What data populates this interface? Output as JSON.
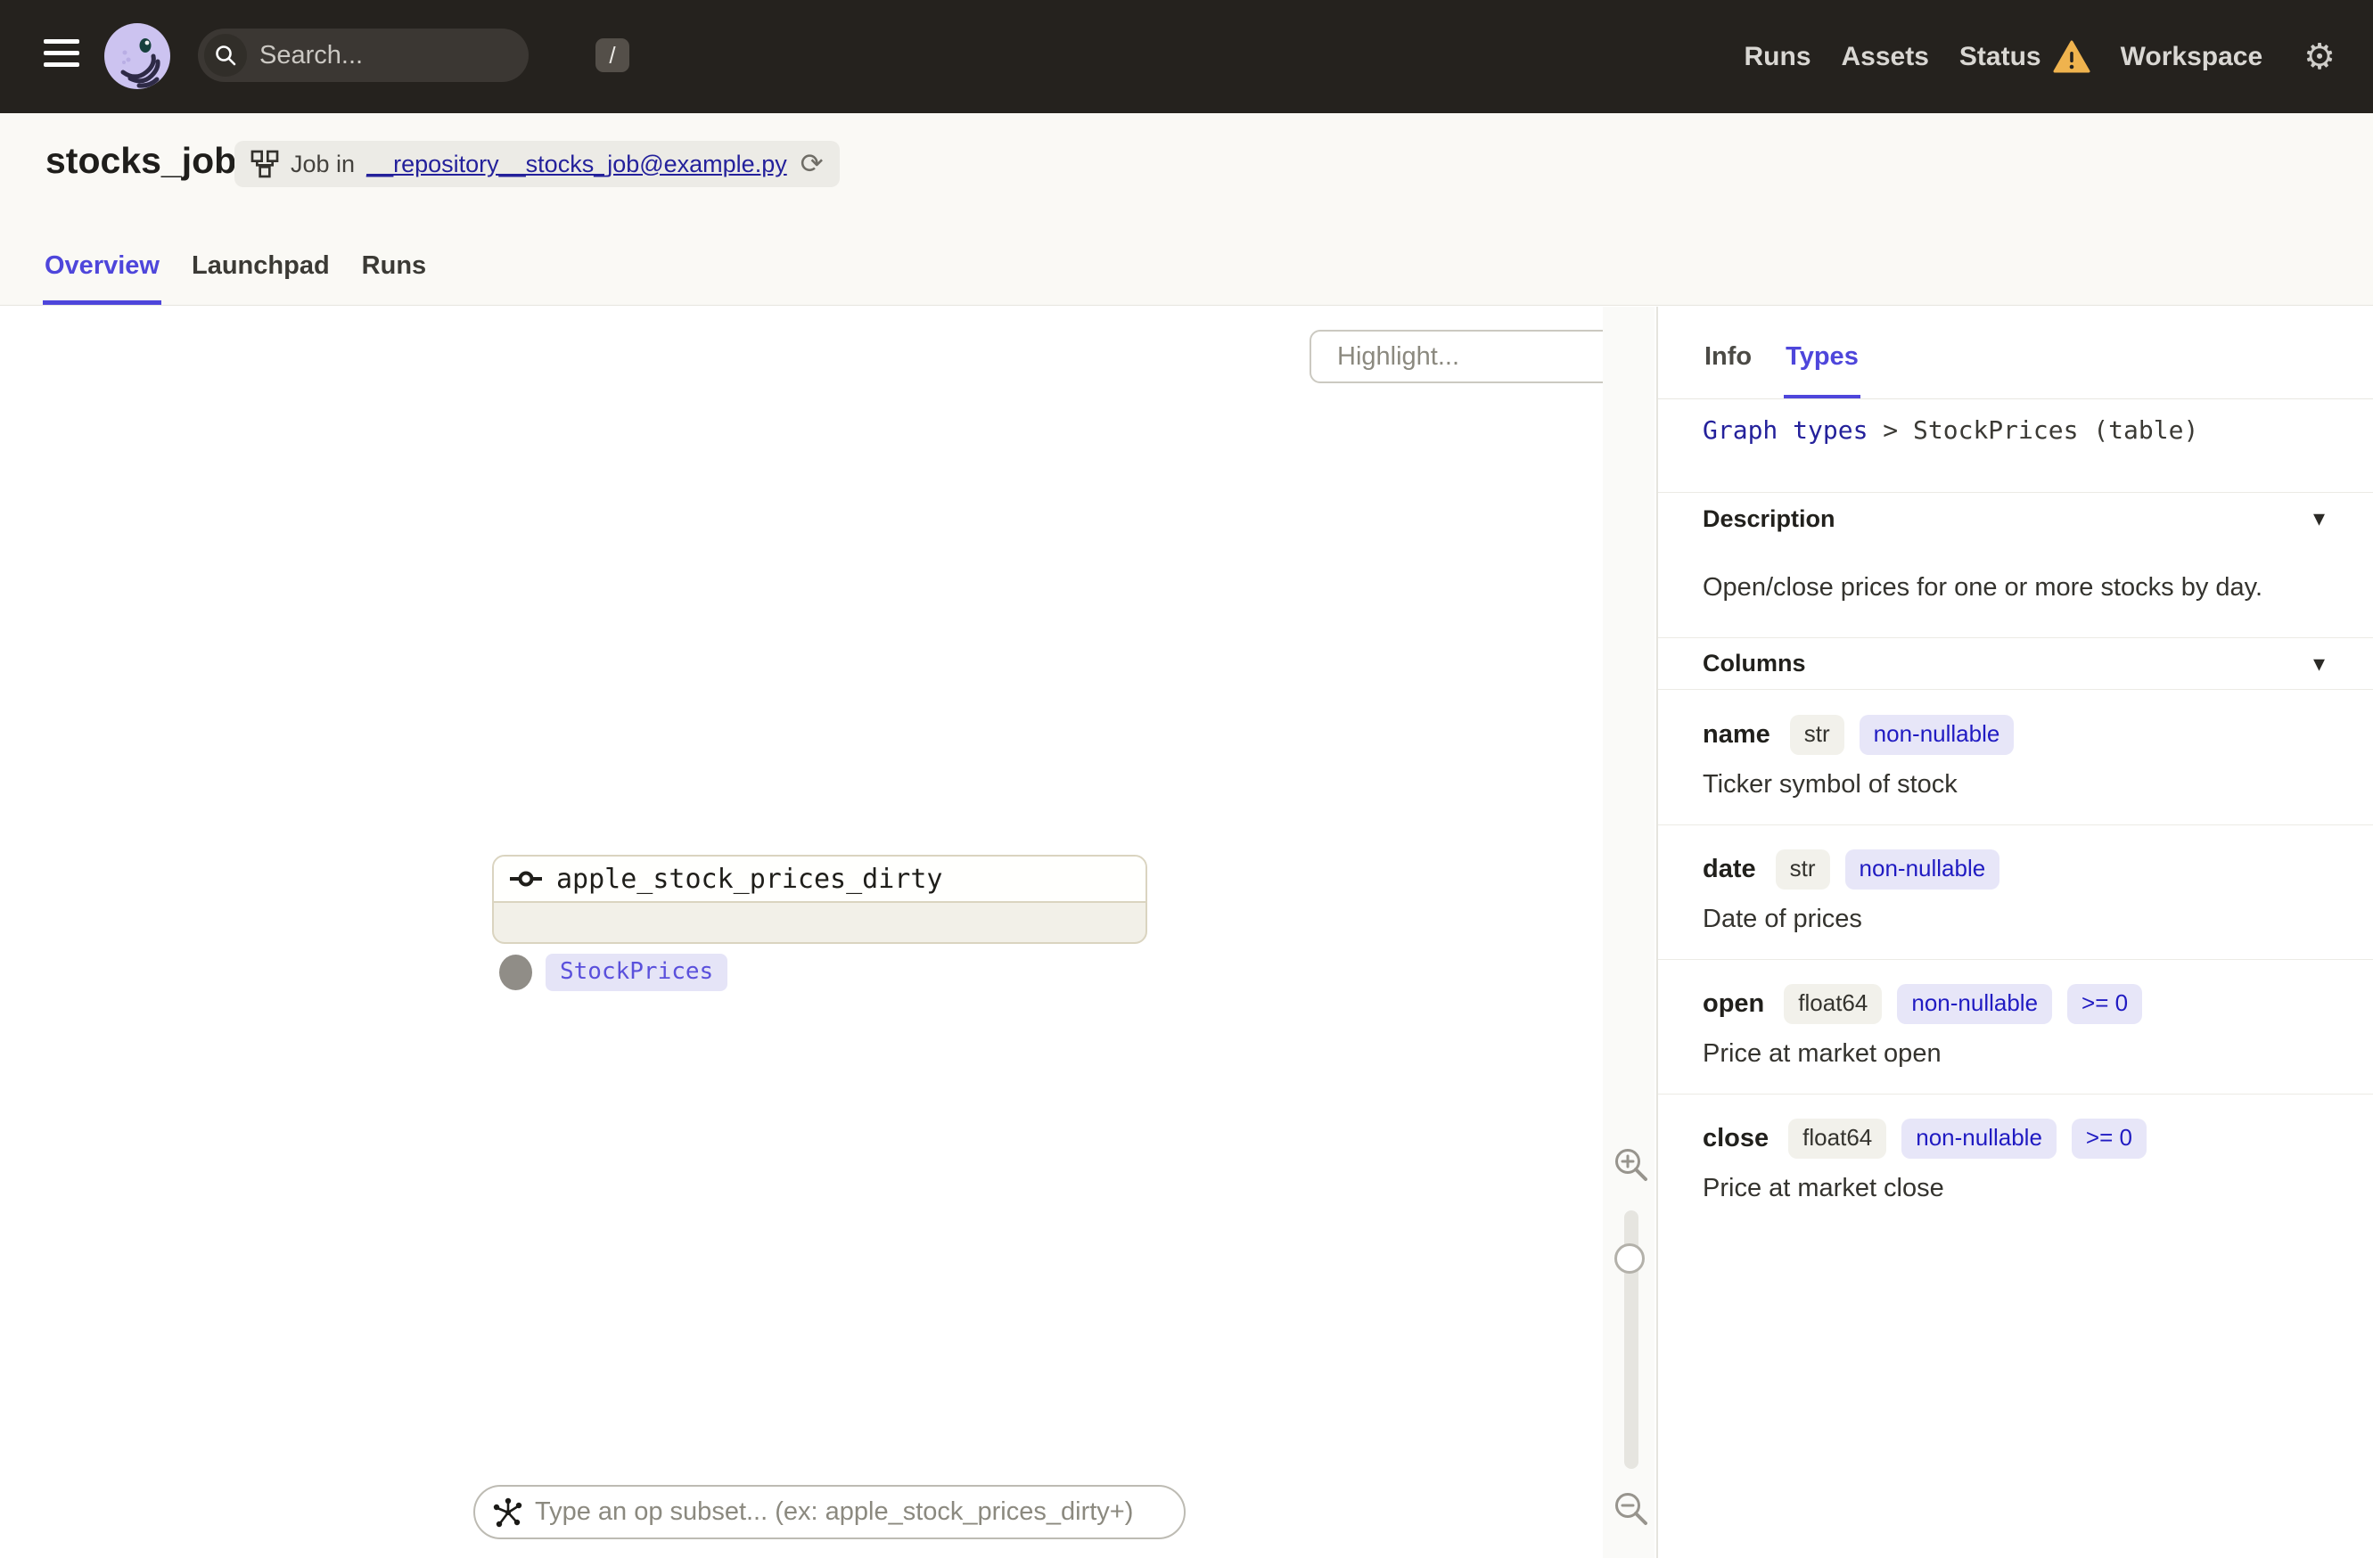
{
  "nav": {
    "search": {
      "placeholder": "Search...",
      "shortcut": "/"
    },
    "items": [
      {
        "label": "Runs"
      },
      {
        "label": "Assets"
      },
      {
        "label": "Status",
        "has_warning": true
      },
      {
        "label": "Workspace"
      }
    ]
  },
  "icons": {
    "gear": "⚙",
    "refresh": "⟳",
    "chevron_down": "▾"
  },
  "header": {
    "title": "stocks_job",
    "job_badge": {
      "prefix": "Job in",
      "link": "__repository__stocks_job@example.py"
    },
    "tabs": [
      {
        "label": "Overview",
        "active": true
      },
      {
        "label": "Launchpad",
        "active": false
      },
      {
        "label": "Runs",
        "active": false
      }
    ]
  },
  "graph": {
    "highlight_placeholder": "Highlight...",
    "node": {
      "name": "apple_stock_prices_dirty",
      "type_tag": "StockPrices"
    },
    "op_subset_placeholder": "Type an op subset... (ex: apple_stock_prices_dirty+)"
  },
  "sidebar": {
    "tabs": [
      {
        "label": "Info",
        "active": false
      },
      {
        "label": "Types",
        "active": true
      }
    ],
    "breadcrumb": {
      "link": "Graph types",
      "separator": ">",
      "current": "StockPrices (table)"
    },
    "description": {
      "title": "Description",
      "text": "Open/close prices for one or more stocks by day."
    },
    "columns": {
      "title": "Columns",
      "rows": [
        {
          "name": "name",
          "type": "str",
          "tags": [
            "non-nullable"
          ],
          "description": "Ticker symbol of stock"
        },
        {
          "name": "date",
          "type": "str",
          "tags": [
            "non-nullable"
          ],
          "description": "Date of prices"
        },
        {
          "name": "open",
          "type": "float64",
          "tags": [
            "non-nullable",
            ">= 0"
          ],
          "description": "Price at market open"
        },
        {
          "name": "close",
          "type": "float64",
          "tags": [
            "non-nullable",
            ">= 0"
          ],
          "description": "Price at market close"
        }
      ]
    }
  },
  "colors": {
    "accent_indigo": "#4e46db",
    "link_navy": "#24219b",
    "warning_amber": "#efb34e",
    "topnav_bg": "#25221e",
    "header_bg": "#faf9f5",
    "node_border_beige": "#dad4c0",
    "tag_bg_lavender": "#e5e4f7",
    "pill_tag_bg": "#e7e6f8",
    "pill_tag_text": "#201bc2"
  }
}
